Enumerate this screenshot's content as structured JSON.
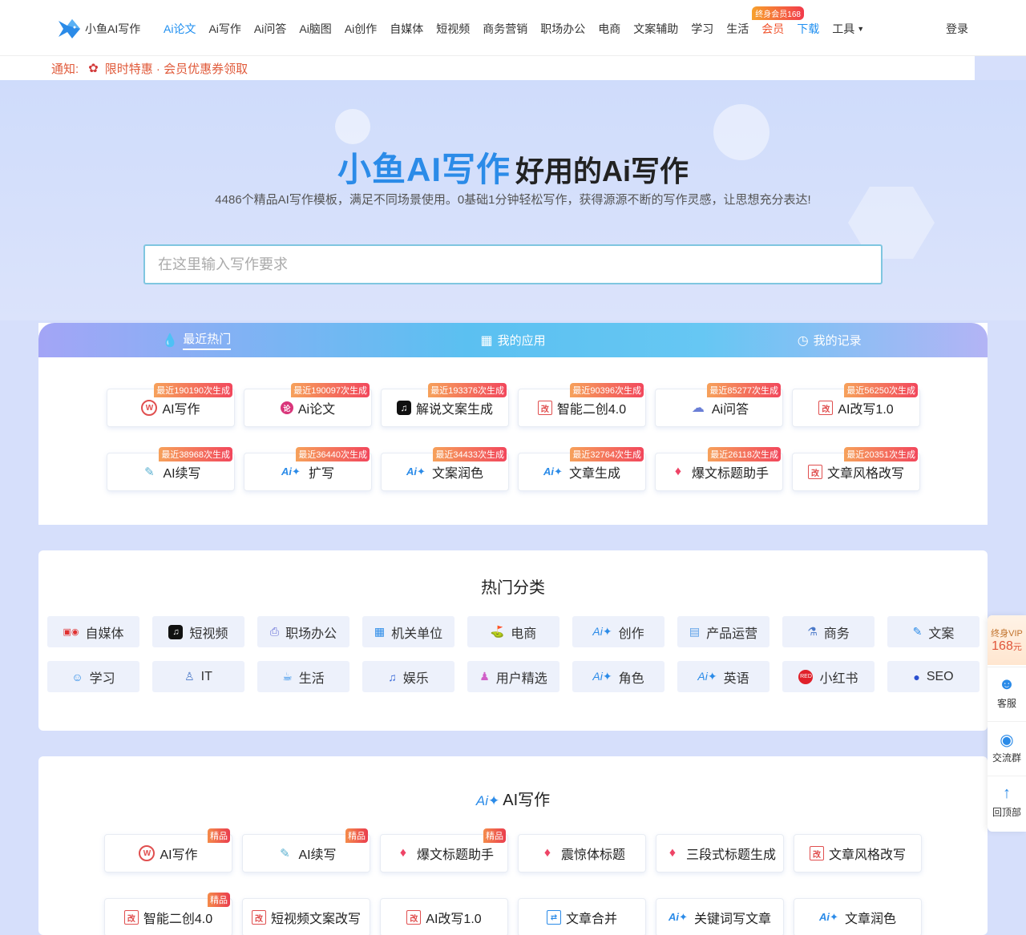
{
  "header": {
    "logo_text": "小鱼AI写作",
    "nav": [
      {
        "label": "Ai论文",
        "active": true
      },
      {
        "label": "Ai写作"
      },
      {
        "label": "Ai问答"
      },
      {
        "label": "Ai脑图"
      },
      {
        "label": "Ai创作"
      },
      {
        "label": "自媒体"
      },
      {
        "label": "短视频"
      },
      {
        "label": "商务营销"
      },
      {
        "label": "职场办公"
      },
      {
        "label": "电商"
      },
      {
        "label": "文案辅助"
      },
      {
        "label": "学习"
      },
      {
        "label": "生活"
      }
    ],
    "vip_label": "会员",
    "vip_tag": "终身会员168",
    "download_label": "下载",
    "tools_label": "工具",
    "login_label": "登录"
  },
  "notice": {
    "label": "通知:",
    "text": "限时特惠 · 会员优惠券领取"
  },
  "hero": {
    "brand": "小鱼AI写作",
    "slogan": "好用的Ai写作",
    "subtitle": "4486个精品AI写作模板，满足不同场景使用。0基础1分钟轻松写作，获得源源不断的写作灵感，让思想充分表达!",
    "search_placeholder": "在这里输入写作要求"
  },
  "tabs": [
    {
      "label": "最近热门",
      "icon": "flame-icon"
    },
    {
      "label": "我的应用",
      "icon": "apps-icon"
    },
    {
      "label": "我的记录",
      "icon": "clock-icon"
    }
  ],
  "hot": [
    {
      "label": "AI写作",
      "badge": "最近190190次生成",
      "icon": "write-icon"
    },
    {
      "label": "Ai论文",
      "badge": "最近190097次生成",
      "icon": "paper-icon"
    },
    {
      "label": "解说文案生成",
      "badge": "最近193376次生成",
      "icon": "tiktok-icon"
    },
    {
      "label": "智能二创4.0",
      "badge": "最近90396次生成",
      "icon": "rewrite-icon"
    },
    {
      "label": "Ai问答",
      "badge": "最近85277次生成",
      "icon": "chat-icon"
    },
    {
      "label": "AI改写1.0",
      "badge": "最近56250次生成",
      "icon": "rewrite-icon"
    },
    {
      "label": "AI续写",
      "badge": "最近38968次生成",
      "icon": "pen-icon"
    },
    {
      "label": "扩写",
      "badge": "最近36440次生成",
      "icon": "ai-icon"
    },
    {
      "label": "文案润色",
      "badge": "最近34433次生成",
      "icon": "ai-icon"
    },
    {
      "label": "文章生成",
      "badge": "最近32764次生成",
      "icon": "ai-icon"
    },
    {
      "label": "爆文标题助手",
      "badge": "最近26118次生成",
      "icon": "tag-icon"
    },
    {
      "label": "文章风格改写",
      "badge": "最近20351次生成",
      "icon": "rewrite-icon"
    }
  ],
  "categories": {
    "title": "热门分类",
    "items": [
      {
        "label": "自媒体",
        "icon": "media-icon"
      },
      {
        "label": "短视频",
        "icon": "tiktok-icon"
      },
      {
        "label": "职场办公",
        "icon": "printer-icon"
      },
      {
        "label": "机关单位",
        "icon": "building-icon"
      },
      {
        "label": "电商",
        "icon": "shop-icon"
      },
      {
        "label": "创作",
        "icon": "ai-icon"
      },
      {
        "label": "产品运营",
        "icon": "presentation-icon"
      },
      {
        "label": "商务",
        "icon": "business-icon"
      },
      {
        "label": "文案",
        "icon": "edit-icon"
      },
      {
        "label": "学习",
        "icon": "user-icon"
      },
      {
        "label": "IT",
        "icon": "developer-icon"
      },
      {
        "label": "生活",
        "icon": "cup-icon"
      },
      {
        "label": "娱乐",
        "icon": "music-icon"
      },
      {
        "label": "用户精选",
        "icon": "users-icon"
      },
      {
        "label": "角色",
        "icon": "ai-icon"
      },
      {
        "label": "英语",
        "icon": "ai-icon"
      },
      {
        "label": "小红书",
        "icon": "xiaohongshu-icon"
      },
      {
        "label": "SEO",
        "icon": "paw-icon"
      }
    ]
  },
  "ai_writing": {
    "title": "AI写作",
    "items": [
      {
        "label": "AI写作",
        "tag": "精品",
        "icon": "write-icon"
      },
      {
        "label": "AI续写",
        "tag": "精品",
        "icon": "pen-icon"
      },
      {
        "label": "爆文标题助手",
        "tag": "精品",
        "icon": "tag-icon"
      },
      {
        "label": "震惊体标题",
        "icon": "tag-icon"
      },
      {
        "label": "三段式标题生成",
        "icon": "tag-icon"
      },
      {
        "label": "文章风格改写",
        "icon": "rewrite-icon"
      },
      {
        "label": "智能二创4.0",
        "tag": "精品",
        "icon": "rewrite-icon"
      },
      {
        "label": "短视频文案改写",
        "icon": "rewrite-icon"
      },
      {
        "label": "AI改写1.0",
        "icon": "rewrite-icon"
      },
      {
        "label": "文章合并",
        "icon": "merge-icon"
      },
      {
        "label": "关键词写文章",
        "icon": "ai-icon"
      },
      {
        "label": "文章润色",
        "icon": "ai-icon"
      }
    ]
  },
  "sidebar": {
    "vip_line1": "终身VIP",
    "vip_price": "168",
    "vip_unit": "元",
    "service": "客服",
    "group": "交流群",
    "top": "回顶部"
  },
  "colors": {
    "brand_blue": "#2b8be8",
    "accent_red": "#f0522b",
    "badge_orange": "#f6a15b"
  }
}
